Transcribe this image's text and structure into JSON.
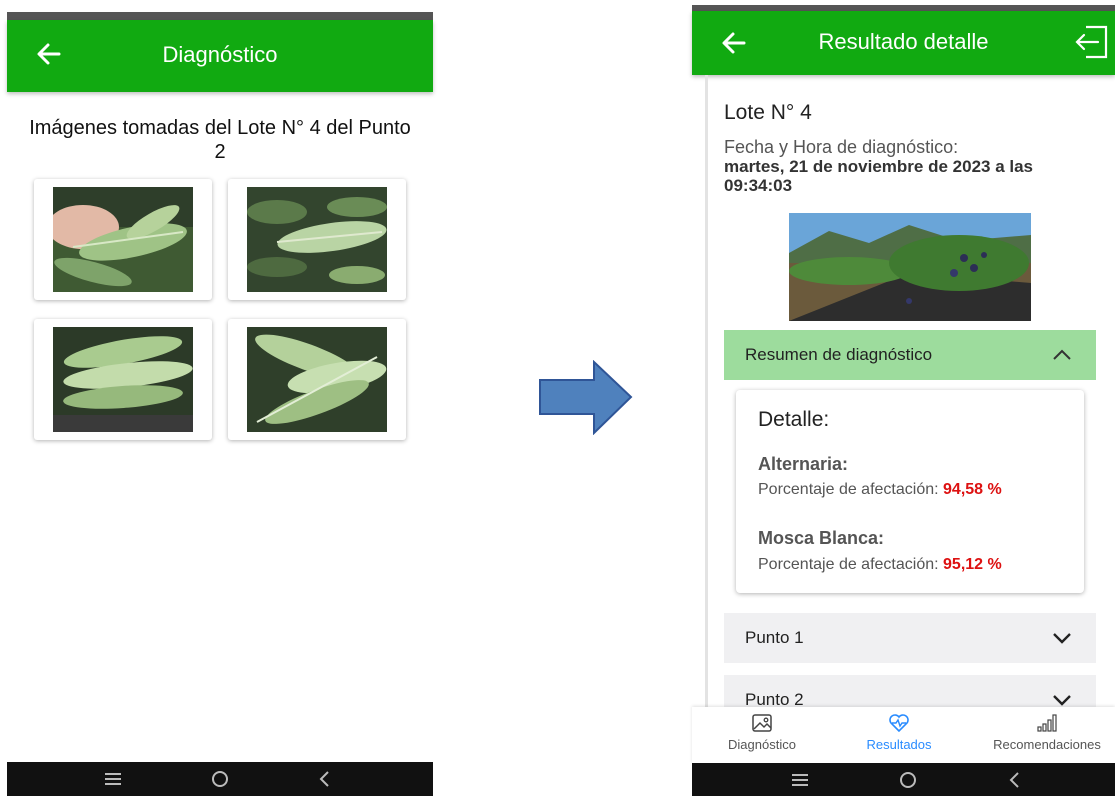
{
  "left_screen": {
    "header": {
      "title": "Diagnóstico"
    },
    "heading": "Imágenes tomadas del Lote N° 4 del Punto 2",
    "images": [
      {
        "icon": "leaf-photo"
      },
      {
        "icon": "leaf-photo"
      },
      {
        "icon": "leaf-photo"
      },
      {
        "icon": "leaf-photo"
      }
    ]
  },
  "right_screen": {
    "header": {
      "title": "Resultado detalle"
    },
    "lote": "Lote N° 4",
    "fecha_label": "Fecha y Hora de diagnóstico:",
    "fecha_value": "martes, 21 de noviembre de 2023 a las 09:34:03",
    "summary": {
      "label": "Resumen de diagnóstico",
      "detail_title": "Detalle:",
      "pests": [
        {
          "name": "Alternaria:",
          "pct_label": "Porcentaje de afectación:",
          "pct_value": "94,58 %"
        },
        {
          "name": "Mosca Blanca:",
          "pct_label": "Porcentaje de afectación:",
          "pct_value": "95,12 %"
        }
      ]
    },
    "points": [
      {
        "label": "Punto 1"
      },
      {
        "label": "Punto 2"
      }
    ],
    "bottom_nav": [
      {
        "label": "Diagnóstico",
        "icon": "image-icon"
      },
      {
        "label": "Resultados",
        "icon": "heart-pulse-icon",
        "active": true
      },
      {
        "label": "Recomendaciones",
        "icon": "signal-bars-icon"
      }
    ]
  },
  "colors": {
    "appbar": "#11aa11",
    "accordion_open": "#9ddc9d",
    "percent": "#dd1111",
    "active_nav": "#2a8cff"
  }
}
